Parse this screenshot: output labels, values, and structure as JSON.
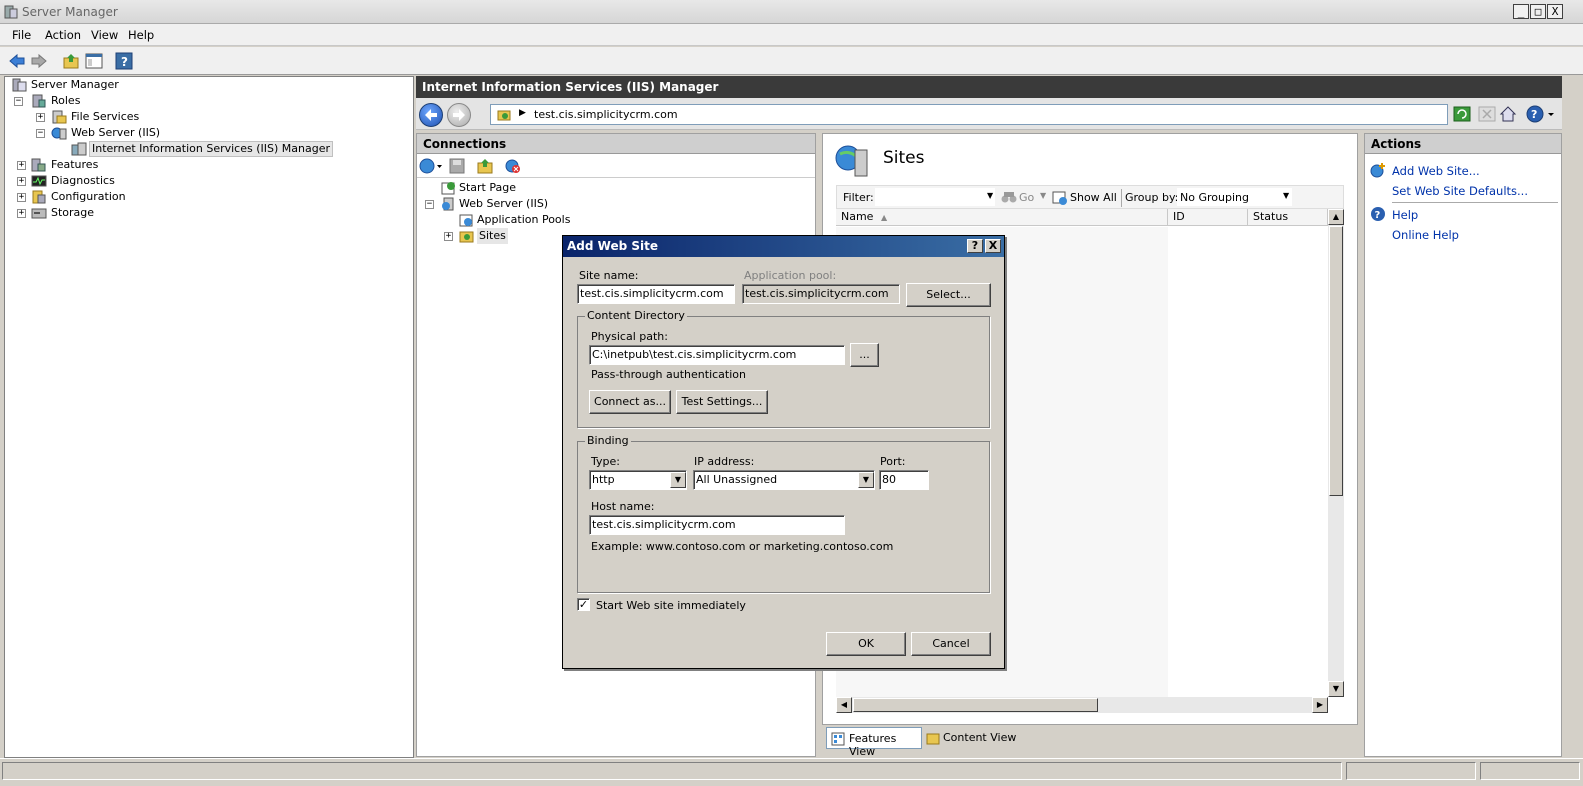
{
  "window": {
    "title": "Server Manager",
    "min": "_",
    "max": "□",
    "close": "X"
  },
  "menu": [
    "File",
    "Action",
    "View",
    "Help"
  ],
  "tree": {
    "root": "Server Manager",
    "roles": "Roles",
    "file_services": "File Services",
    "web_server": "Web Server (IIS)",
    "iis_manager": "Internet Information Services (IIS) Manager",
    "features": "Features",
    "diagnostics": "Diagnostics",
    "configuration": "Configuration",
    "storage": "Storage"
  },
  "iis": {
    "header": "Internet Information Services (IIS) Manager",
    "address": "test.cis.simplicitycrm.com",
    "connections_title": "Connections",
    "conn_tree": {
      "start_page": "Start Page",
      "web_server": "Web Server (IIS)",
      "app_pools": "Application Pools",
      "sites": "Sites"
    },
    "sites_title": "Sites",
    "filter_label": "Filter:",
    "go_label": "Go",
    "show_all_label": "Show All",
    "group_by_label": "Group by:",
    "grouping_value": "No Grouping",
    "columns": [
      "Name",
      "ID",
      "Status"
    ],
    "features_view": "Features View",
    "content_view": "Content View",
    "actions_title": "Actions",
    "actions": {
      "add_web_site": "Add Web Site...",
      "set_defaults": "Set Web Site Defaults...",
      "help": "Help",
      "online_help": "Online Help"
    }
  },
  "dialog": {
    "title": "Add Web Site",
    "help_btn": "?",
    "close_btn": "X",
    "site_name_label": "Site name:",
    "site_name_value": "test.cis.simplicitycrm.com",
    "app_pool_label": "Application pool:",
    "app_pool_value": "test.cis.simplicitycrm.com",
    "select_button": "Select...",
    "content_dir_legend": "Content Directory",
    "physical_path_label": "Physical path:",
    "physical_path_value": "C:\\inetpub\\test.cis.simplicitycrm.com",
    "browse_button": "...",
    "passthrough_label": "Pass-through authentication",
    "connect_as_button": "Connect as...",
    "test_settings_button": "Test Settings...",
    "binding_legend": "Binding",
    "type_label": "Type:",
    "type_value": "http",
    "ip_label": "IP address:",
    "ip_value": "All Unassigned",
    "port_label": "Port:",
    "port_value": "80",
    "host_label": "Host name:",
    "host_value": "test.cis.simplicitycrm.com",
    "example_text": "Example: www.contoso.com or marketing.contoso.com",
    "start_immediately_label": "Start Web site immediately",
    "start_immediately_checked": true,
    "ok_button": "OK",
    "cancel_button": "Cancel"
  }
}
